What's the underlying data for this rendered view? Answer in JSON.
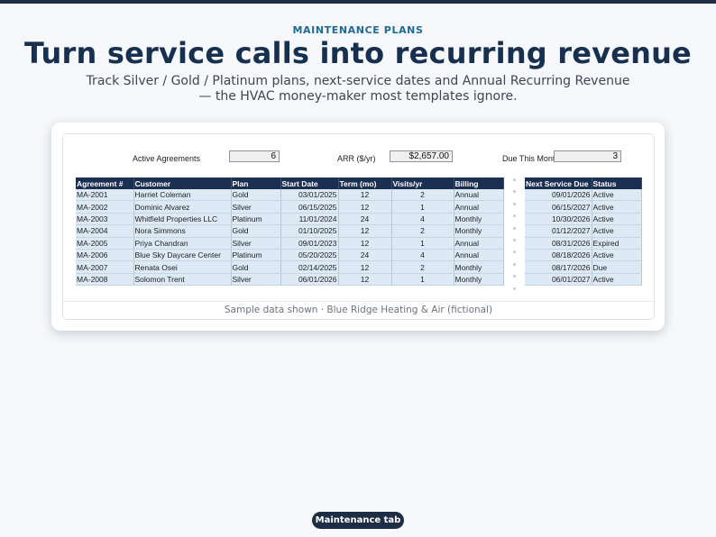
{
  "hero": {
    "eyebrow": "MAINTENANCE PLANS",
    "title": "Turn service calls into recurring revenue",
    "subtitle": "Track Silver / Gold / Platinum plans, next-service dates and Annual Recurring Revenue — the HVAC money-maker most templates ignore."
  },
  "metrics": {
    "active_label": "Active Agreements",
    "active_value": "6",
    "arr_label": "ARR ($/yr)",
    "arr_value": "$2,657.00",
    "due_label": "Due This Month",
    "due_value": "3"
  },
  "table": {
    "headers": [
      "Agreement #",
      "Customer",
      "Plan",
      "Start Date",
      "Term (mo)",
      "Visits/yr",
      "Billing"
    ],
    "rows": [
      [
        "MA-2001",
        "Harriet Coleman",
        "Gold",
        "03/01/2025",
        "12",
        "2",
        "Annual"
      ],
      [
        "MA-2002",
        "Dominic Alvarez",
        "Silver",
        "06/15/2025",
        "12",
        "1",
        "Annual"
      ],
      [
        "MA-2003",
        "Whitfield Properties LLC",
        "Platinum",
        "11/01/2024",
        "24",
        "4",
        "Monthly"
      ],
      [
        "MA-2004",
        "Nora Simmons",
        "Gold",
        "01/10/2025",
        "12",
        "2",
        "Monthly"
      ],
      [
        "MA-2005",
        "Priya Chandran",
        "Silver",
        "09/01/2023",
        "12",
        "1",
        "Annual"
      ],
      [
        "MA-2006",
        "Blue Sky Daycare Center",
        "Platinum",
        "05/20/2025",
        "24",
        "4",
        "Annual"
      ],
      [
        "MA-2007",
        "Renata Osei",
        "Gold",
        "02/14/2025",
        "12",
        "2",
        "Monthly"
      ],
      [
        "MA-2008",
        "Solomon Trent",
        "Silver",
        "06/01/2026",
        "12",
        "1",
        "Monthly"
      ]
    ]
  },
  "service_table": {
    "headers": [
      "Next Service Due",
      "Status"
    ],
    "rows": [
      [
        "09/01/2026",
        "Active"
      ],
      [
        "06/15/2027",
        "Active"
      ],
      [
        "10/30/2026",
        "Active"
      ],
      [
        "01/12/2027",
        "Active"
      ],
      [
        "08/31/2026",
        "Expired"
      ],
      [
        "08/18/2026",
        "Active"
      ],
      [
        "08/17/2026",
        "Due"
      ],
      [
        "06/01/2027",
        "Active"
      ]
    ]
  },
  "footnote": "Sample data shown · Blue Ridge Heating & Air (fictional)",
  "tab_label": "Maintenance tab",
  "colors": {
    "navy": "#1b2f52",
    "accent": "#1d6a9a",
    "cell": "#ddeaf6"
  }
}
